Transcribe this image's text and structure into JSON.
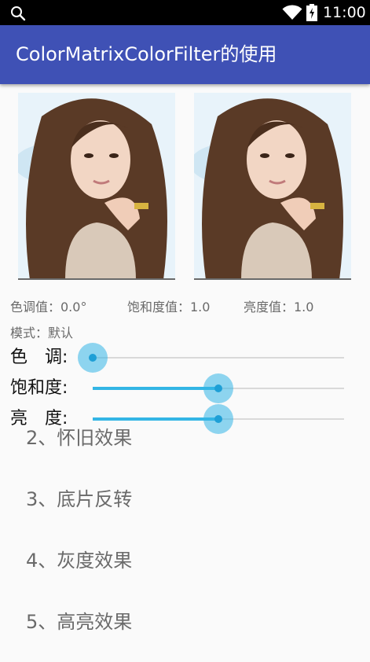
{
  "status_bar": {
    "time": "11:00"
  },
  "app_bar": {
    "title": "ColorMatrixColorFilter的使用"
  },
  "values": {
    "hue": "色调值：0.0°",
    "saturation": "饱和度值：1.0",
    "brightness": "亮度值：1.0"
  },
  "mode": "模式：默认",
  "sliders": [
    {
      "label": "色　调:",
      "value": 0.0
    },
    {
      "label": "饱和度:",
      "value": 0.5
    },
    {
      "label": "亮　度:",
      "value": 0.5
    }
  ],
  "menu": [
    "2、怀旧效果",
    "3、底片反转",
    "4、灰度效果",
    "5、高亮效果"
  ],
  "colors": {
    "app_bar": "#3f51b5",
    "accent": "#33b5e5"
  },
  "icons": [
    "search-icon",
    "wifi-icon",
    "battery-icon"
  ]
}
